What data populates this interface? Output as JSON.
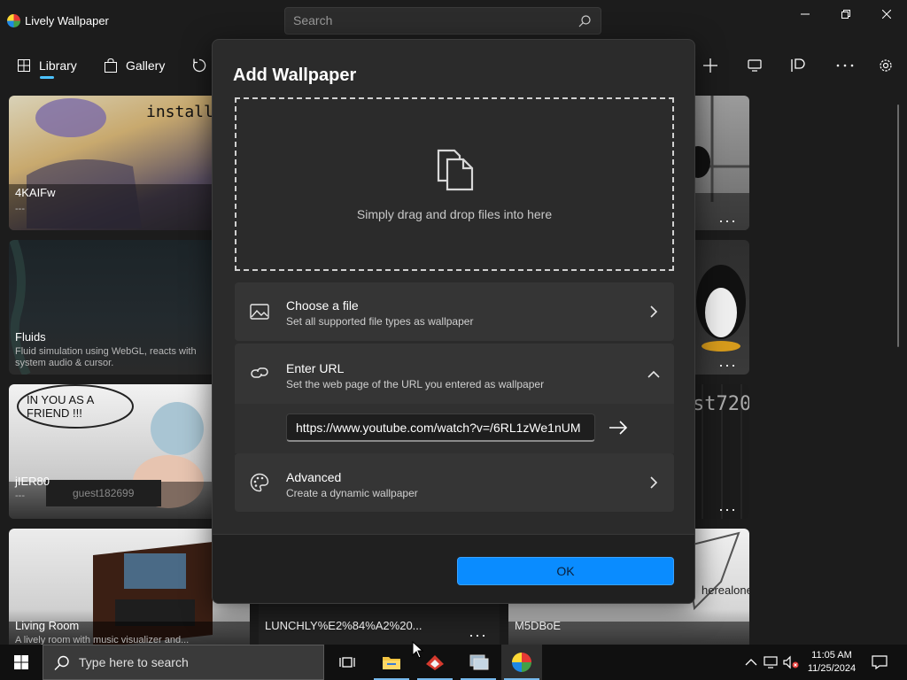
{
  "app": {
    "title": "Lively Wallpaper"
  },
  "search": {
    "placeholder": "Search"
  },
  "nav": {
    "items": [
      {
        "label": "Library",
        "icon": "grid-icon",
        "selected": true
      },
      {
        "label": "Gallery",
        "icon": "shopping-bag-icon"
      }
    ],
    "actions": [
      "refresh-icon",
      "add-icon",
      "monitor-icon",
      "control-panel-icon",
      "more-icon",
      "settings-icon"
    ],
    "accent": "#4cc2ff"
  },
  "library": {
    "cards": [
      {
        "title": "4KAIFw",
        "desc": "---"
      },
      {
        "title": "Fluids",
        "desc": "Fluid simulation using WebGL, reacts with system audio & cursor."
      },
      {
        "title": "jIER80",
        "desc": "---"
      },
      {
        "title": "Living Room",
        "desc": "A lively room with music visualizer and..."
      },
      {
        "title": "LUNCHLY%E2%84%A2%20..."
      },
      {
        "title": "M5DBoE"
      }
    ],
    "card_art_text": {
      "installer": "installer",
      "friend": "IN YOU AS A FRIEND !!!",
      "guest": "guest182699",
      "st720": "st720",
      "herealone": "herealone"
    },
    "more_label": "···"
  },
  "dialog": {
    "title": "Add Wallpaper",
    "drop_text": "Simply drag and drop files into here",
    "options": [
      {
        "title": "Choose a file",
        "subtitle": "Set all supported file types as wallpaper",
        "icon": "image-icon",
        "chevron": "chevron-right-icon"
      },
      {
        "title": "Enter URL",
        "subtitle": "Set the web page of the URL you entered as wallpaper",
        "icon": "link-icon",
        "chevron": "chevron-up-icon",
        "expanded": true
      },
      {
        "title": "Advanced",
        "subtitle": "Create a dynamic wallpaper",
        "icon": "palette-icon",
        "chevron": "chevron-right-icon"
      }
    ],
    "url_value": "https://www.youtube.com/watch?v=/6RL1zWe1nUM",
    "ok_label": "OK",
    "ok_color": "#0a8cff"
  },
  "taskbar": {
    "search_placeholder": "Type here to search",
    "apps": [
      "task-view-icon",
      "file-explorer-icon",
      "app-red-icon",
      "app-network-icon",
      "lively-icon"
    ],
    "time": "11:05 AM",
    "date": "11/25/2024"
  }
}
